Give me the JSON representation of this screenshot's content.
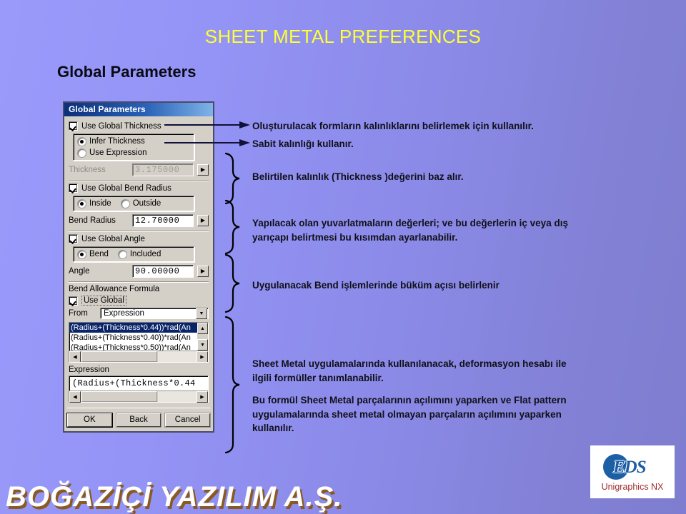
{
  "slide": {
    "title": "SHEET METAL PREFERENCES",
    "section_heading": "Global Parameters",
    "title_color": "#ffff33"
  },
  "dialog": {
    "title": "Global Parameters",
    "use_global_thickness": "Use Global Thickness",
    "infer_thickness": "Infer Thickness",
    "use_expression": "Use Expression",
    "thickness_label": "Thickness",
    "thickness_value": "3.175000",
    "use_global_bend_radius": "Use Global Bend Radius",
    "inside": "Inside",
    "outside": "Outside",
    "bend_radius_label": "Bend Radius",
    "bend_radius_value": "12.70000",
    "use_global_angle": "Use Global Angle",
    "bend": "Bend",
    "included": "Included",
    "angle_label": "Angle",
    "angle_value": "90.00000",
    "bend_allowance_formula": "Bend Allowance Formula",
    "use_global": "Use Global",
    "from_label": "From",
    "from_value": "Expression",
    "formula_list": [
      "(Radius+(Thickness*0.44))*rad(An",
      "(Radius+(Thickness*0.40))*rad(An",
      "(Radius+(Thickness*0.50))*rad(An"
    ],
    "expression_label": "Expression",
    "expression_value": "(Radius+(Thickness*0.44",
    "buttons": {
      "ok": "OK",
      "back": "Back",
      "cancel": "Cancel"
    },
    "icons": {
      "spinner": "▶",
      "combo_down": "▼",
      "scroll_up": "▲",
      "scroll_down": "▼",
      "scroll_left": "◀",
      "scroll_right": "▶"
    }
  },
  "annotations": {
    "thickness_use": "Oluşturulacak formların kalınlıklarını belirlemek için kullanılır.",
    "fixed_thickness": "Sabit kalınlığı kullanır.",
    "specified_thickness": "Belirtilen kalınlık (Thickness )değerini baz alır.",
    "bend_radius": "Yapılacak olan yuvarlatmaların değerleri; ve bu değerlerin iç veya dış yarıçapı belirtmesi bu kısımdan ayarlanabilir.",
    "angle": "Uygulanacak Bend işlemlerinde büküm açısı belirlenir",
    "formula_1": "Sheet Metal uygulamalarında kullanılanacak, deformasyon hesabı ile ilgili formüller tanımlanabilir.",
    "formula_2": "Bu formül Sheet Metal parçalarının açılımını yaparken ve Flat pattern uygulamalarında sheet metal olmayan parçaların açılımını yaparken kullanılır."
  },
  "logo": {
    "brand": "EDS",
    "product": "Unigraphics NX",
    "brand_color": "#1d5fa5",
    "product_color": "#9e2b2b"
  },
  "footer": {
    "watermark": "BOĞAZİÇİ YAZILIM A.Ş."
  }
}
